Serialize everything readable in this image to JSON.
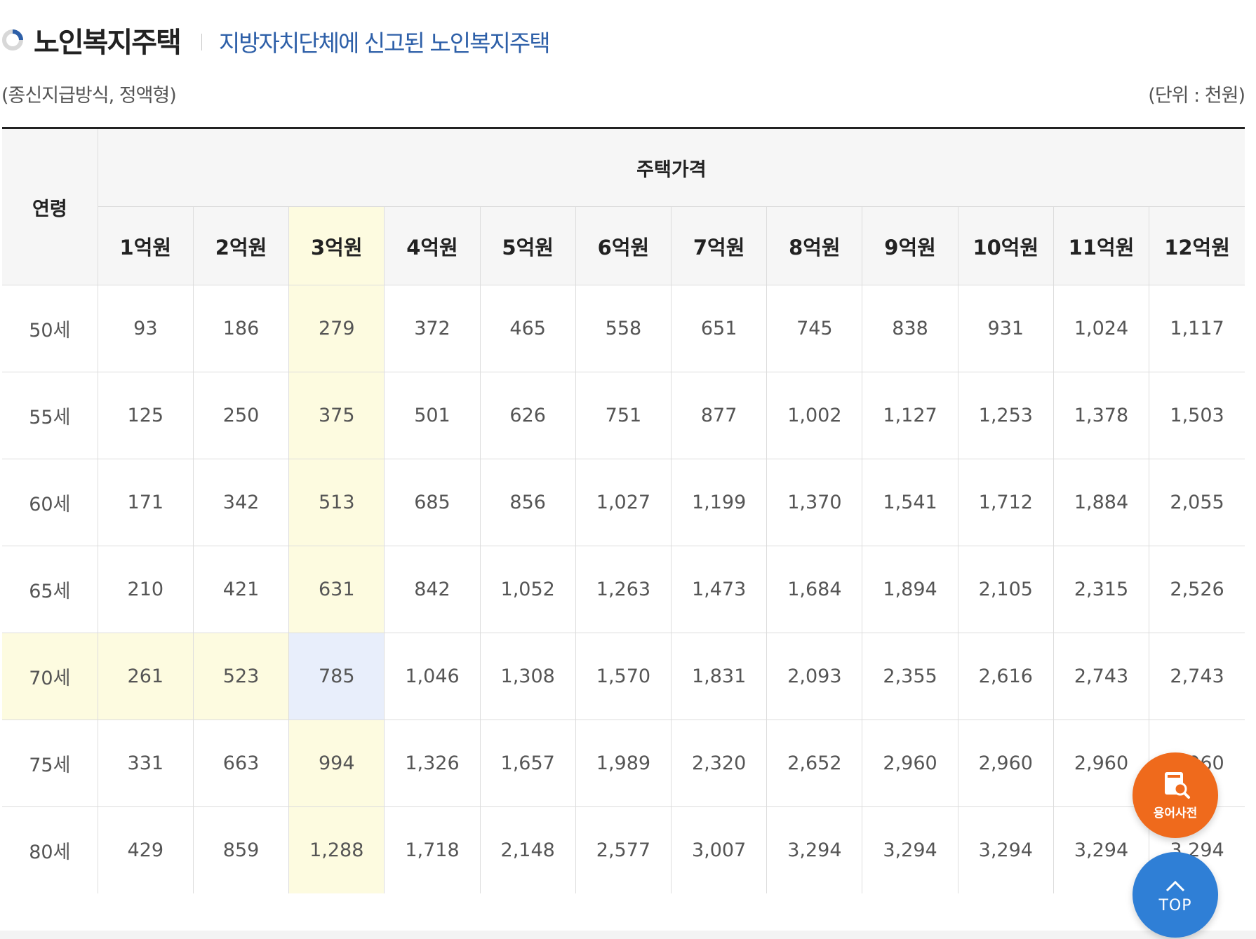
{
  "header": {
    "title": "노인복지주택",
    "subtitle": "지방자치단체에 신고된 노인복지주택"
  },
  "notes": {
    "left": "(종신지급방식, 정액형)",
    "right": "(단위 : 천원)"
  },
  "table": {
    "age_header": "연령",
    "price_group_header": "주택가격",
    "price_columns": [
      "1억원",
      "2억원",
      "3억원",
      "4억원",
      "5억원",
      "6억원",
      "7억원",
      "8억원",
      "9억원",
      "10억원",
      "11억원",
      "12억원"
    ],
    "rows": [
      {
        "age": "50세",
        "values": [
          "93",
          "186",
          "279",
          "372",
          "465",
          "558",
          "651",
          "745",
          "838",
          "931",
          "1,024",
          "1,117"
        ]
      },
      {
        "age": "55세",
        "values": [
          "125",
          "250",
          "375",
          "501",
          "626",
          "751",
          "877",
          "1,002",
          "1,127",
          "1,253",
          "1,378",
          "1,503"
        ]
      },
      {
        "age": "60세",
        "values": [
          "171",
          "342",
          "513",
          "685",
          "856",
          "1,027",
          "1,199",
          "1,370",
          "1,541",
          "1,712",
          "1,884",
          "2,055"
        ]
      },
      {
        "age": "65세",
        "values": [
          "210",
          "421",
          "631",
          "842",
          "1,052",
          "1,263",
          "1,473",
          "1,684",
          "1,894",
          "2,105",
          "2,315",
          "2,526"
        ]
      },
      {
        "age": "70세",
        "values": [
          "261",
          "523",
          "785",
          "1,046",
          "1,308",
          "1,570",
          "1,831",
          "2,093",
          "2,355",
          "2,616",
          "2,743",
          "2,743"
        ]
      },
      {
        "age": "75세",
        "values": [
          "331",
          "663",
          "994",
          "1,326",
          "1,657",
          "1,989",
          "2,320",
          "2,652",
          "2,960",
          "2,960",
          "2,960",
          "2,960"
        ]
      },
      {
        "age": "80세",
        "values": [
          "429",
          "859",
          "1,288",
          "1,718",
          "2,148",
          "2,577",
          "3,007",
          "3,294",
          "3,294",
          "3,294",
          "3,294",
          "3,294"
        ]
      }
    ],
    "highlight": {
      "column_index": 2,
      "row_index": 4,
      "row_highlight_until_column": 1,
      "column_color": "#fdfbe0",
      "cell_color": "#e8eefb"
    }
  },
  "floating": {
    "dictionary_label": "용어사전",
    "top_label": "TOP",
    "dictionary_color": "#ef6a1c",
    "top_color": "#2f7fd6"
  },
  "colors": {
    "title_accent": "#2d5fa8",
    "header_bg": "#f6f6f6",
    "grid_line": "#dddddd"
  }
}
